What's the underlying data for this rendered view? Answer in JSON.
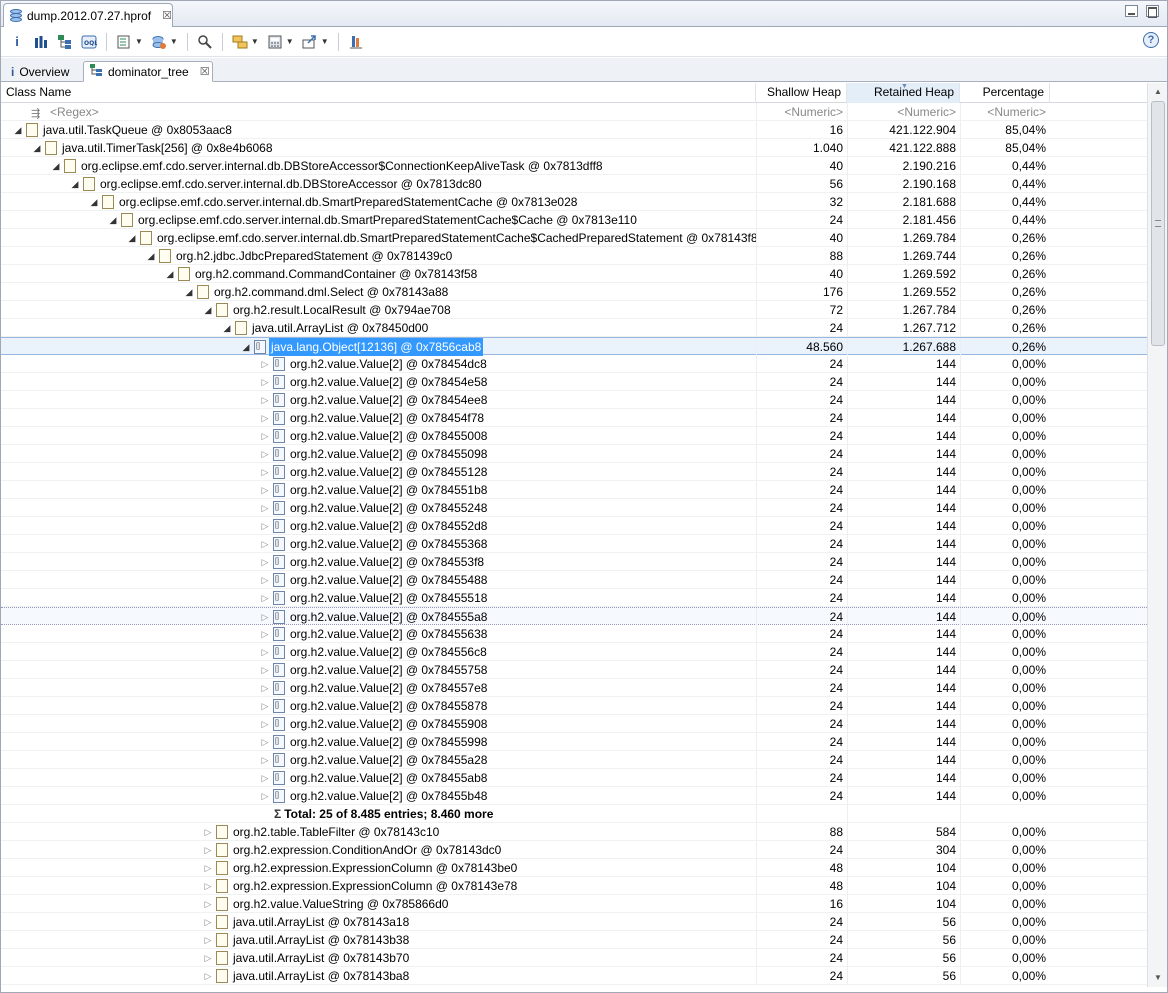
{
  "editor_tab": {
    "title": "dump.2012.07.27.hprof",
    "close": "☒"
  },
  "toolbar": {
    "help": "?"
  },
  "tabs": [
    {
      "label": "Overview"
    },
    {
      "label": "dominator_tree"
    }
  ],
  "columns": {
    "class_name": "Class Name",
    "shallow_heap": "Shallow Heap",
    "retained_heap": "Retained Heap",
    "percentage": "Percentage",
    "sort_column": "Retained Heap"
  },
  "filter_row": {
    "class_name": "<Regex>",
    "shallow_heap": "<Numeric>",
    "retained_heap": "<Numeric>",
    "percentage": "<Numeric>"
  },
  "rows": [
    {
      "name": "java.util.TaskQueue @ 0x8053aac8",
      "shallow": "16",
      "retained": "421.122.904",
      "pct": "85,04%",
      "level": 0,
      "expanded": true,
      "icon": "class-file"
    },
    {
      "name": "java.util.TimerTask[256] @ 0x8e4b6068",
      "shallow": "1.040",
      "retained": "421.122.888",
      "pct": "85,04%",
      "level": 1,
      "expanded": true,
      "icon": "class-file"
    },
    {
      "name": "org.eclipse.emf.cdo.server.internal.db.DBStoreAccessor$ConnectionKeepAliveTask @ 0x7813dff8",
      "shallow": "40",
      "retained": "2.190.216",
      "pct": "0,44%",
      "level": 2,
      "expanded": true,
      "icon": "class-file"
    },
    {
      "name": "org.eclipse.emf.cdo.server.internal.db.DBStoreAccessor @ 0x7813dc80",
      "shallow": "56",
      "retained": "2.190.168",
      "pct": "0,44%",
      "level": 3,
      "expanded": true,
      "icon": "class-file"
    },
    {
      "name": "org.eclipse.emf.cdo.server.internal.db.SmartPreparedStatementCache @ 0x7813e028",
      "shallow": "32",
      "retained": "2.181.688",
      "pct": "0,44%",
      "level": 4,
      "expanded": true,
      "icon": "class-file"
    },
    {
      "name": "org.eclipse.emf.cdo.server.internal.db.SmartPreparedStatementCache$Cache @ 0x7813e110",
      "shallow": "24",
      "retained": "2.181.456",
      "pct": "0,44%",
      "level": 5,
      "expanded": true,
      "icon": "class-file"
    },
    {
      "name": "org.eclipse.emf.cdo.server.internal.db.SmartPreparedStatementCache$CachedPreparedStatement @ 0x78143f80",
      "shallow": "40",
      "retained": "1.269.784",
      "pct": "0,26%",
      "level": 6,
      "expanded": true,
      "icon": "class-file"
    },
    {
      "name": "org.h2.jdbc.JdbcPreparedStatement @ 0x781439c0",
      "shallow": "88",
      "retained": "1.269.744",
      "pct": "0,26%",
      "level": 7,
      "expanded": true,
      "icon": "class-file"
    },
    {
      "name": "org.h2.command.CommandContainer @ 0x78143f58",
      "shallow": "40",
      "retained": "1.269.592",
      "pct": "0,26%",
      "level": 8,
      "expanded": true,
      "icon": "class-file"
    },
    {
      "name": "org.h2.command.dml.Select @ 0x78143a88",
      "shallow": "176",
      "retained": "1.269.552",
      "pct": "0,26%",
      "level": 9,
      "expanded": true,
      "icon": "class-file"
    },
    {
      "name": "org.h2.result.LocalResult @ 0x794ae708",
      "shallow": "72",
      "retained": "1.267.784",
      "pct": "0,26%",
      "level": 10,
      "expanded": true,
      "icon": "class-file"
    },
    {
      "name": "java.util.ArrayList @ 0x78450d00",
      "shallow": "24",
      "retained": "1.267.712",
      "pct": "0,26%",
      "level": 11,
      "expanded": true,
      "icon": "class-file"
    },
    {
      "name": "java.lang.Object[12136] @ 0x7856cab8",
      "shallow": "48.560",
      "retained": "1.267.688",
      "pct": "0,26%",
      "level": 12,
      "expanded": true,
      "icon": "array",
      "selected": true
    },
    {
      "name": "org.h2.value.Value[2] @ 0x78454dc8",
      "shallow": "24",
      "retained": "144",
      "pct": "0,00%",
      "level": 13,
      "expanded": false,
      "icon": "array"
    },
    {
      "name": "org.h2.value.Value[2] @ 0x78454e58",
      "shallow": "24",
      "retained": "144",
      "pct": "0,00%",
      "level": 13,
      "expanded": false,
      "icon": "array"
    },
    {
      "name": "org.h2.value.Value[2] @ 0x78454ee8",
      "shallow": "24",
      "retained": "144",
      "pct": "0,00%",
      "level": 13,
      "expanded": false,
      "icon": "array"
    },
    {
      "name": "org.h2.value.Value[2] @ 0x78454f78",
      "shallow": "24",
      "retained": "144",
      "pct": "0,00%",
      "level": 13,
      "expanded": false,
      "icon": "array"
    },
    {
      "name": "org.h2.value.Value[2] @ 0x78455008",
      "shallow": "24",
      "retained": "144",
      "pct": "0,00%",
      "level": 13,
      "expanded": false,
      "icon": "array"
    },
    {
      "name": "org.h2.value.Value[2] @ 0x78455098",
      "shallow": "24",
      "retained": "144",
      "pct": "0,00%",
      "level": 13,
      "expanded": false,
      "icon": "array"
    },
    {
      "name": "org.h2.value.Value[2] @ 0x78455128",
      "shallow": "24",
      "retained": "144",
      "pct": "0,00%",
      "level": 13,
      "expanded": false,
      "icon": "array"
    },
    {
      "name": "org.h2.value.Value[2] @ 0x784551b8",
      "shallow": "24",
      "retained": "144",
      "pct": "0,00%",
      "level": 13,
      "expanded": false,
      "icon": "array"
    },
    {
      "name": "org.h2.value.Value[2] @ 0x78455248",
      "shallow": "24",
      "retained": "144",
      "pct": "0,00%",
      "level": 13,
      "expanded": false,
      "icon": "array"
    },
    {
      "name": "org.h2.value.Value[2] @ 0x784552d8",
      "shallow": "24",
      "retained": "144",
      "pct": "0,00%",
      "level": 13,
      "expanded": false,
      "icon": "array"
    },
    {
      "name": "org.h2.value.Value[2] @ 0x78455368",
      "shallow": "24",
      "retained": "144",
      "pct": "0,00%",
      "level": 13,
      "expanded": false,
      "icon": "array"
    },
    {
      "name": "org.h2.value.Value[2] @ 0x784553f8",
      "shallow": "24",
      "retained": "144",
      "pct": "0,00%",
      "level": 13,
      "expanded": false,
      "icon": "array"
    },
    {
      "name": "org.h2.value.Value[2] @ 0x78455488",
      "shallow": "24",
      "retained": "144",
      "pct": "0,00%",
      "level": 13,
      "expanded": false,
      "icon": "array"
    },
    {
      "name": "org.h2.value.Value[2] @ 0x78455518",
      "shallow": "24",
      "retained": "144",
      "pct": "0,00%",
      "level": 13,
      "expanded": false,
      "icon": "array"
    },
    {
      "name": "org.h2.value.Value[2] @ 0x784555a8",
      "shallow": "24",
      "retained": "144",
      "pct": "0,00%",
      "level": 13,
      "expanded": false,
      "icon": "array",
      "hover": true
    },
    {
      "name": "org.h2.value.Value[2] @ 0x78455638",
      "shallow": "24",
      "retained": "144",
      "pct": "0,00%",
      "level": 13,
      "expanded": false,
      "icon": "array"
    },
    {
      "name": "org.h2.value.Value[2] @ 0x784556c8",
      "shallow": "24",
      "retained": "144",
      "pct": "0,00%",
      "level": 13,
      "expanded": false,
      "icon": "array"
    },
    {
      "name": "org.h2.value.Value[2] @ 0x78455758",
      "shallow": "24",
      "retained": "144",
      "pct": "0,00%",
      "level": 13,
      "expanded": false,
      "icon": "array"
    },
    {
      "name": "org.h2.value.Value[2] @ 0x784557e8",
      "shallow": "24",
      "retained": "144",
      "pct": "0,00%",
      "level": 13,
      "expanded": false,
      "icon": "array"
    },
    {
      "name": "org.h2.value.Value[2] @ 0x78455878",
      "shallow": "24",
      "retained": "144",
      "pct": "0,00%",
      "level": 13,
      "expanded": false,
      "icon": "array"
    },
    {
      "name": "org.h2.value.Value[2] @ 0x78455908",
      "shallow": "24",
      "retained": "144",
      "pct": "0,00%",
      "level": 13,
      "expanded": false,
      "icon": "array"
    },
    {
      "name": "org.h2.value.Value[2] @ 0x78455998",
      "shallow": "24",
      "retained": "144",
      "pct": "0,00%",
      "level": 13,
      "expanded": false,
      "icon": "array"
    },
    {
      "name": "org.h2.value.Value[2] @ 0x78455a28",
      "shallow": "24",
      "retained": "144",
      "pct": "0,00%",
      "level": 13,
      "expanded": false,
      "icon": "array"
    },
    {
      "name": "org.h2.value.Value[2] @ 0x78455ab8",
      "shallow": "24",
      "retained": "144",
      "pct": "0,00%",
      "level": 13,
      "expanded": false,
      "icon": "array"
    },
    {
      "name": "org.h2.value.Value[2] @ 0x78455b48",
      "shallow": "24",
      "retained": "144",
      "pct": "0,00%",
      "level": 13,
      "expanded": false,
      "icon": "array"
    },
    {
      "name": "Total: 25 of 8.485 entries; 8.460 more",
      "shallow": "",
      "retained": "",
      "pct": "",
      "level": 13,
      "total": true
    },
    {
      "name": "org.h2.table.TableFilter @ 0x78143c10",
      "shallow": "88",
      "retained": "584",
      "pct": "0,00%",
      "level": 10,
      "expanded": false,
      "icon": "class-file"
    },
    {
      "name": "org.h2.expression.ConditionAndOr @ 0x78143dc0",
      "shallow": "24",
      "retained": "304",
      "pct": "0,00%",
      "level": 10,
      "expanded": false,
      "icon": "class-file"
    },
    {
      "name": "org.h2.expression.ExpressionColumn @ 0x78143be0",
      "shallow": "48",
      "retained": "104",
      "pct": "0,00%",
      "level": 10,
      "expanded": false,
      "icon": "class-file"
    },
    {
      "name": "org.h2.expression.ExpressionColumn @ 0x78143e78",
      "shallow": "48",
      "retained": "104",
      "pct": "0,00%",
      "level": 10,
      "expanded": false,
      "icon": "class-file"
    },
    {
      "name": "org.h2.value.ValueString @ 0x785866d0",
      "shallow": "16",
      "retained": "104",
      "pct": "0,00%",
      "level": 10,
      "expanded": false,
      "icon": "class-file"
    },
    {
      "name": "java.util.ArrayList @ 0x78143a18",
      "shallow": "24",
      "retained": "56",
      "pct": "0,00%",
      "level": 10,
      "expanded": false,
      "icon": "class-file"
    },
    {
      "name": "java.util.ArrayList @ 0x78143b38",
      "shallow": "24",
      "retained": "56",
      "pct": "0,00%",
      "level": 10,
      "expanded": false,
      "icon": "class-file"
    },
    {
      "name": "java.util.ArrayList @ 0x78143b70",
      "shallow": "24",
      "retained": "56",
      "pct": "0,00%",
      "level": 10,
      "expanded": false,
      "icon": "class-file"
    },
    {
      "name": "java.util.ArrayList @ 0x78143ba8",
      "shallow": "24",
      "retained": "56",
      "pct": "0,00%",
      "level": 10,
      "expanded": false,
      "icon": "class-file"
    }
  ],
  "colors": {
    "selection": "#3399ff",
    "header_sorted": "#e3eef9"
  }
}
